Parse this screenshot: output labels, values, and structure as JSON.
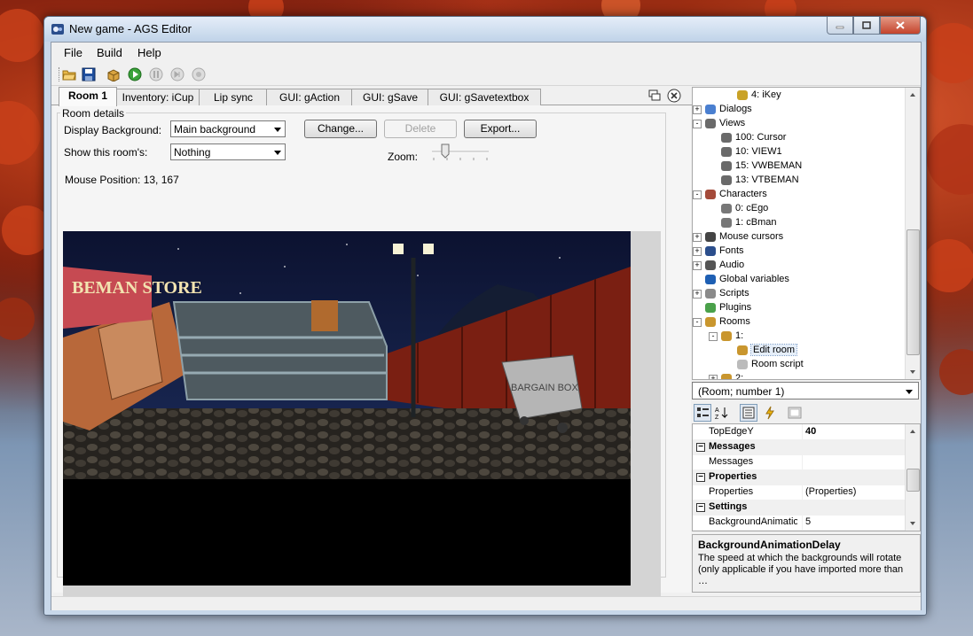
{
  "window": {
    "title": "New game - AGS Editor"
  },
  "menu": [
    "File",
    "Build",
    "Help"
  ],
  "toolbar": {
    "icons": [
      "open-folder-icon",
      "save-icon",
      "build-package-icon",
      "run-icon",
      "pause-icon",
      "step-icon",
      "stop-icon"
    ]
  },
  "tabs": [
    "Room 1",
    "Inventory: iCup",
    "Lip sync",
    "GUI: gAction",
    "GUI: gSave",
    "GUI: gSavetextbox"
  ],
  "room": {
    "group_label": "Room details",
    "display_bg_label": "Display Background:",
    "display_bg_value": "Main background",
    "show_label": "Show this room's:",
    "show_value": "Nothing",
    "change_label": "Change...",
    "delete_label": "Delete",
    "export_label": "Export...",
    "zoom_label": "Zoom:",
    "mouse_pos": "Mouse Position: 13, 167",
    "scene_sign": "BEMAN STORE",
    "scene_box": "BARGAIN BOX"
  },
  "tree": [
    {
      "label": "4: iKey",
      "icon": "key-icon",
      "level": 2,
      "expander": ""
    },
    {
      "label": "Dialogs",
      "icon": "speech-bubble-icon",
      "level": 0,
      "expander": "+"
    },
    {
      "label": "Views",
      "icon": "glasses-icon",
      "level": 0,
      "expander": "-"
    },
    {
      "label": "100: Cursor",
      "icon": "glasses-icon",
      "level": 1,
      "expander": ""
    },
    {
      "label": "10: VIEW1",
      "icon": "glasses-icon",
      "level": 1,
      "expander": ""
    },
    {
      "label": "15: VWBEMAN",
      "icon": "glasses-icon",
      "level": 1,
      "expander": ""
    },
    {
      "label": "13: VTBEMAN",
      "icon": "glasses-icon",
      "level": 1,
      "expander": ""
    },
    {
      "label": "Characters",
      "icon": "characters-icon",
      "level": 0,
      "expander": "-"
    },
    {
      "label": "0: cEgo",
      "icon": "character-icon",
      "level": 1,
      "expander": ""
    },
    {
      "label": "1: cBman",
      "icon": "character-icon",
      "level": 1,
      "expander": ""
    },
    {
      "label": "Mouse cursors",
      "icon": "cursor-icon",
      "level": 0,
      "expander": "+"
    },
    {
      "label": "Fonts",
      "icon": "font-icon",
      "level": 0,
      "expander": "+"
    },
    {
      "label": "Audio",
      "icon": "speaker-icon",
      "level": 0,
      "expander": "+"
    },
    {
      "label": "Global variables",
      "icon": "globe-icon",
      "level": 0,
      "expander": ""
    },
    {
      "label": "Scripts",
      "icon": "script-icon",
      "level": 0,
      "expander": "+"
    },
    {
      "label": "Plugins",
      "icon": "puzzle-icon",
      "level": 0,
      "expander": ""
    },
    {
      "label": "Rooms",
      "icon": "room-box-icon",
      "level": 0,
      "expander": "-"
    },
    {
      "label": "1:",
      "icon": "room-box-icon",
      "level": 1,
      "expander": "-"
    },
    {
      "label": "Edit room",
      "icon": "edit-room-icon",
      "level": 2,
      "expander": ""
    },
    {
      "label": "Room script",
      "icon": "document-icon",
      "level": 2,
      "expander": ""
    },
    {
      "label": "2:",
      "icon": "room-box-icon",
      "level": 1,
      "expander": "+"
    }
  ],
  "object_combo": "(Room; number 1)",
  "properties": [
    {
      "type": "prop",
      "name": "TopEdgeY",
      "value": "40",
      "bold": true
    },
    {
      "type": "cat",
      "name": "Messages"
    },
    {
      "type": "prop",
      "name": "Messages",
      "value": ""
    },
    {
      "type": "cat",
      "name": "Properties"
    },
    {
      "type": "prop",
      "name": "Properties",
      "value": "(Properties)"
    },
    {
      "type": "cat",
      "name": "Settings"
    },
    {
      "type": "prop",
      "name": "BackgroundAnimation",
      "value": "5"
    }
  ],
  "description": {
    "title": "BackgroundAnimationDelay",
    "text": "The speed at which the backgrounds will rotate (only applicable if you have imported more than …"
  }
}
